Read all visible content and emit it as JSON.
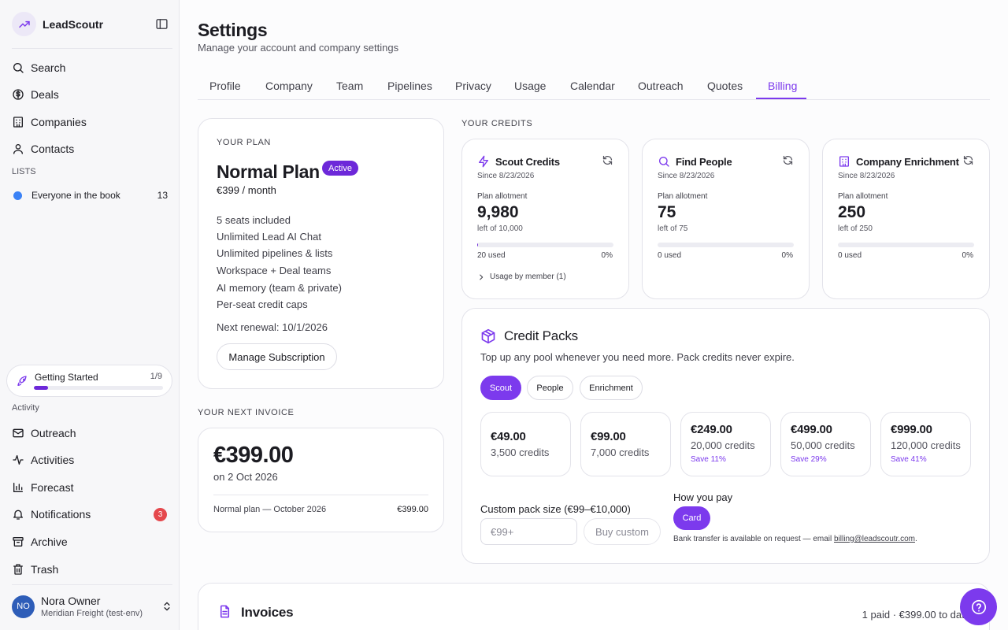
{
  "brand": {
    "name": "LeadScoutr"
  },
  "sidebar": {
    "nav": [
      {
        "label": "Search"
      },
      {
        "label": "Deals"
      },
      {
        "label": "Companies"
      },
      {
        "label": "Contacts"
      }
    ],
    "lists_heading": "LISTS",
    "lists": [
      {
        "label": "Everyone in the book",
        "count": "13"
      }
    ],
    "getting_started": {
      "label": "Getting Started",
      "count": "1/9",
      "progress": 0.11
    },
    "activity_heading": "Activity",
    "activity": [
      {
        "label": "Outreach"
      },
      {
        "label": "Activities"
      },
      {
        "label": "Forecast"
      },
      {
        "label": "Notifications",
        "badge": "3"
      },
      {
        "label": "Archive"
      },
      {
        "label": "Trash"
      }
    ],
    "user": {
      "initials": "NO",
      "name": "Nora Owner",
      "org": "Meridian Freight (test-env)"
    }
  },
  "header": {
    "title": "Settings",
    "subtitle": "Manage your account and company settings"
  },
  "tabs": [
    "Profile",
    "Company",
    "Team",
    "Pipelines",
    "Privacy",
    "Usage",
    "Calendar",
    "Outreach",
    "Quotes",
    "Billing"
  ],
  "active_tab": "Billing",
  "plan": {
    "kicker": "YOUR PLAN",
    "name": "Normal Plan",
    "status": "Active",
    "price": "€399 / month",
    "features": [
      "5 seats included",
      "Unlimited Lead AI Chat",
      "Unlimited pipelines & lists",
      "Workspace + Deal teams",
      "AI memory (team & private)",
      "Per-seat credit caps"
    ],
    "renewal": "Next renewal: 10/1/2026",
    "manage_label": "Manage Subscription"
  },
  "next_invoice": {
    "kicker": "YOUR NEXT INVOICE",
    "amount": "€399.00",
    "date": "on 2 Oct 2026",
    "line_desc": "Normal plan — October 2026",
    "line_value": "€399.00"
  },
  "credits": {
    "kicker": "YOUR CREDITS",
    "cards": [
      {
        "title": "Scout Credits",
        "icon": "bolt-icon",
        "since": "Since 8/23/2026",
        "allot_label": "Plan allotment",
        "value": "9,980",
        "left": "left of 10,000",
        "used": "20 used",
        "pct": "0%",
        "fill": 0.002,
        "usage_member": "Usage by member (1)"
      },
      {
        "title": "Find People",
        "icon": "search-icon",
        "since": "Since 8/23/2026",
        "allot_label": "Plan allotment",
        "value": "75",
        "left": "left of 75",
        "used": "0 used",
        "pct": "0%",
        "fill": 0
      },
      {
        "title": "Company Enrichment",
        "icon": "building-icon",
        "since": "Since 8/23/2026",
        "allot_label": "Plan allotment",
        "value": "250",
        "left": "left of 250",
        "used": "0 used",
        "pct": "0%",
        "fill": 0
      }
    ]
  },
  "credit_packs": {
    "title": "Credit Packs",
    "subtitle": "Top up any pool whenever you need more. Pack credits never expire.",
    "pills": [
      "Scout",
      "People",
      "Enrichment"
    ],
    "active_pill": "Scout",
    "packs": [
      {
        "price": "€49.00",
        "credits": "3,500 credits",
        "save": ""
      },
      {
        "price": "€99.00",
        "credits": "7,000 credits",
        "save": ""
      },
      {
        "price": "€249.00",
        "credits": "20,000 credits",
        "save": "Save 11%"
      },
      {
        "price": "€499.00",
        "credits": "50,000 credits",
        "save": "Save 29%"
      },
      {
        "price": "€999.00",
        "credits": "120,000 credits",
        "save": "Save 41%"
      }
    ],
    "custom_label": "Custom pack size (€99–€10,000)",
    "custom_placeholder": "€99+",
    "buy_custom": "Buy custom",
    "howpay_label": "How you pay",
    "pay_method": "Card",
    "bank_note": "Bank transfer is available on request — email ",
    "bank_email": "billing@leadscoutr.com",
    "bank_note_end": "."
  },
  "invoices": {
    "title": "Invoices",
    "summary": "1 paid · €399.00 to date"
  },
  "colors": {
    "accent": "#7c3aed",
    "badge": "#e5484d",
    "avatar": "#2e5db8",
    "list_dot": "#3b82f6"
  }
}
